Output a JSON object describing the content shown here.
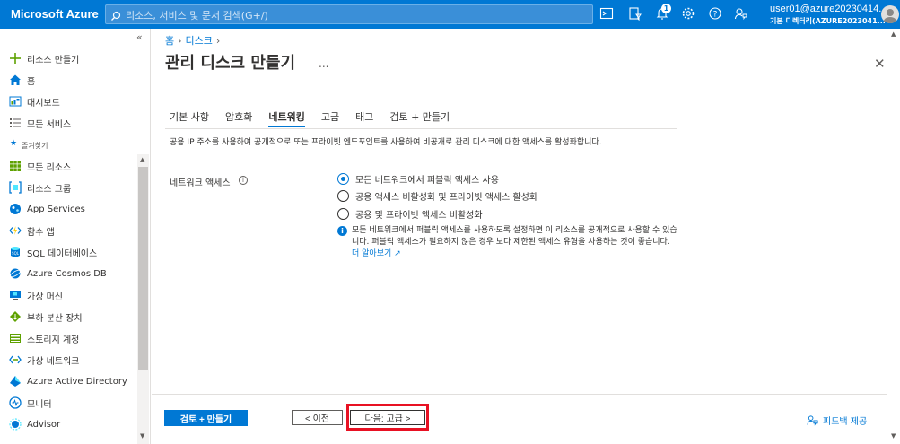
{
  "topbar": {
    "brand": "Microsoft Azure",
    "search_placeholder": "리소스, 서비스 및 문서 검색(G+/)",
    "notification_count": "1",
    "user_email": "user01@azure20230414...",
    "user_tenant": "기본 디렉터리(AZURE2023041..."
  },
  "sidebar": {
    "items": [
      {
        "label": "리소스 만들기",
        "icon": "plus-icon"
      },
      {
        "label": "홈",
        "icon": "home-icon"
      },
      {
        "label": "대시보드",
        "icon": "dashboard-icon"
      },
      {
        "label": "모든 서비스",
        "icon": "list-icon"
      }
    ],
    "favorites_label": "즐겨찾기",
    "favorites": [
      {
        "label": "모든 리소스",
        "icon": "grid-icon"
      },
      {
        "label": "리소스 그룹",
        "icon": "resource-group-icon"
      },
      {
        "label": "App Services",
        "icon": "app-services-icon"
      },
      {
        "label": "함수 앱",
        "icon": "function-app-icon"
      },
      {
        "label": "SQL 데이터베이스",
        "icon": "sql-database-icon"
      },
      {
        "label": "Azure Cosmos DB",
        "icon": "cosmos-db-icon"
      },
      {
        "label": "가상 머신",
        "icon": "virtual-machine-icon"
      },
      {
        "label": "부하 분산 장치",
        "icon": "load-balancer-icon"
      },
      {
        "label": "스토리지 계정",
        "icon": "storage-account-icon"
      },
      {
        "label": "가상 네트워크",
        "icon": "virtual-network-icon"
      },
      {
        "label": "Azure Active Directory",
        "icon": "active-directory-icon"
      },
      {
        "label": "모니터",
        "icon": "monitor-icon"
      },
      {
        "label": "Advisor",
        "icon": "advisor-icon"
      }
    ]
  },
  "main": {
    "breadcrumb": [
      "홈",
      "디스크"
    ],
    "title": "관리 디스크 만들기",
    "title_more": "...",
    "tabs": [
      {
        "label": "기본 사항",
        "active": false
      },
      {
        "label": "암호화",
        "active": false
      },
      {
        "label": "네트워킹",
        "active": true
      },
      {
        "label": "고급",
        "active": false
      },
      {
        "label": "태그",
        "active": false
      },
      {
        "label": "검토 + 만들기",
        "active": false
      }
    ],
    "intro": "공용 IP 주소를 사용하여 공개적으로 또는 프라이빗 엔드포인트를 사용하여 비공개로 관리 디스크에 대한 액세스를 활성화합니다.",
    "network_access_label": "네트워크 액세스",
    "options": [
      {
        "label": "모든 네트워크에서 퍼블릭 액세스 사용",
        "selected": true
      },
      {
        "label": "공용 액세스 비활성화 및 프라이빗 액세스 활성화",
        "selected": false
      },
      {
        "label": "공용 및 프라이빗 액세스 비활성화",
        "selected": false
      }
    ],
    "info_text": "모든 네트워크에서 퍼블릭 액세스를 사용하도록 설정하면 이 리소스를 공개적으로 사용할 수 있습니다. 퍼블릭 액세스가 필요하지 않은 경우 보다 제한된 액세스 유형을 사용하는 것이 좋습니다.",
    "learn_more": "더 알아보기"
  },
  "footer": {
    "review_create": "검토 + 만들기",
    "previous": "< 이전",
    "next": "다음: 고급 >",
    "feedback": "피드백 제공"
  },
  "colors": {
    "azure_blue": "#0078d4",
    "highlight_red": "#e81123"
  }
}
